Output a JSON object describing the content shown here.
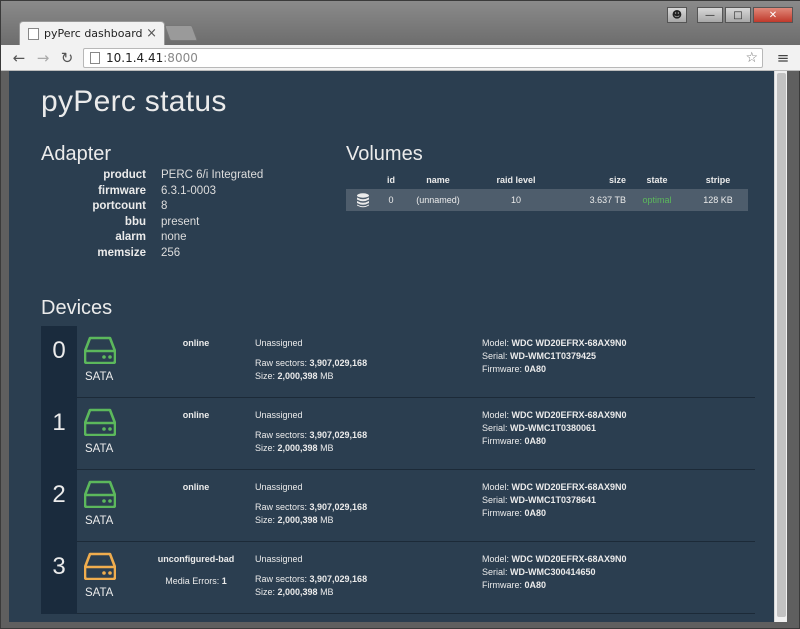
{
  "browser": {
    "tab_title": "pyPerc dashboard",
    "url_host": "10.1.4.41",
    "url_port": ":8000"
  },
  "page": {
    "title": "pyPerc status",
    "adapter_title": "Adapter",
    "volumes_title": "Volumes",
    "devices_title": "Devices"
  },
  "adapter": [
    {
      "key": "product",
      "value": "PERC 6/i Integrated"
    },
    {
      "key": "firmware",
      "value": "6.3.1-0003"
    },
    {
      "key": "portcount",
      "value": "8"
    },
    {
      "key": "bbu",
      "value": "present"
    },
    {
      "key": "alarm",
      "value": "none"
    },
    {
      "key": "memsize",
      "value": "256"
    }
  ],
  "volumes": {
    "headers": {
      "id": "id",
      "name": "name",
      "raid": "raid level",
      "size": "size",
      "state": "state",
      "stripe": "stripe"
    },
    "rows": [
      {
        "id": "0",
        "name": "(unnamed)",
        "raid": "10",
        "size": "3.637 TB",
        "state": "optimal",
        "stripe": "128 KB"
      }
    ]
  },
  "devices": [
    {
      "num": "0",
      "type": "SATA",
      "status": "online",
      "media_errors": "",
      "assignment": "Unassigned",
      "raw_sectors": "3,907,029,168",
      "size": "2,000,398",
      "model": "WDC WD20EFRX-68AX9N0",
      "serial": "WD-WMC1T0379425",
      "firmware": "0A80",
      "color": "#5cb85c"
    },
    {
      "num": "1",
      "type": "SATA",
      "status": "online",
      "media_errors": "",
      "assignment": "Unassigned",
      "raw_sectors": "3,907,029,168",
      "size": "2,000,398",
      "model": "WDC WD20EFRX-68AX9N0",
      "serial": "WD-WMC1T0380061",
      "firmware": "0A80",
      "color": "#5cb85c"
    },
    {
      "num": "2",
      "type": "SATA",
      "status": "online",
      "media_errors": "",
      "assignment": "Unassigned",
      "raw_sectors": "3,907,029,168",
      "size": "2,000,398",
      "model": "WDC WD20EFRX-68AX9N0",
      "serial": "WD-WMC1T0378641",
      "firmware": "0A80",
      "color": "#5cb85c"
    },
    {
      "num": "3",
      "type": "SATA",
      "status": "unconfigured-bad",
      "media_errors": "1",
      "assignment": "Unassigned",
      "raw_sectors": "3,907,029,168",
      "size": "2,000,398",
      "model": "WDC WD20EFRX-68AX9N0",
      "serial": "WD-WMC300414650",
      "firmware": "0A80",
      "color": "#f0ad4e"
    }
  ],
  "labels": {
    "raw_sectors": "Raw sectors: ",
    "size": "Size: ",
    "mb": " MB",
    "model": "Model: ",
    "serial": "Serial: ",
    "firmware": "Firmware: ",
    "media_errors": "Media Errors: "
  }
}
